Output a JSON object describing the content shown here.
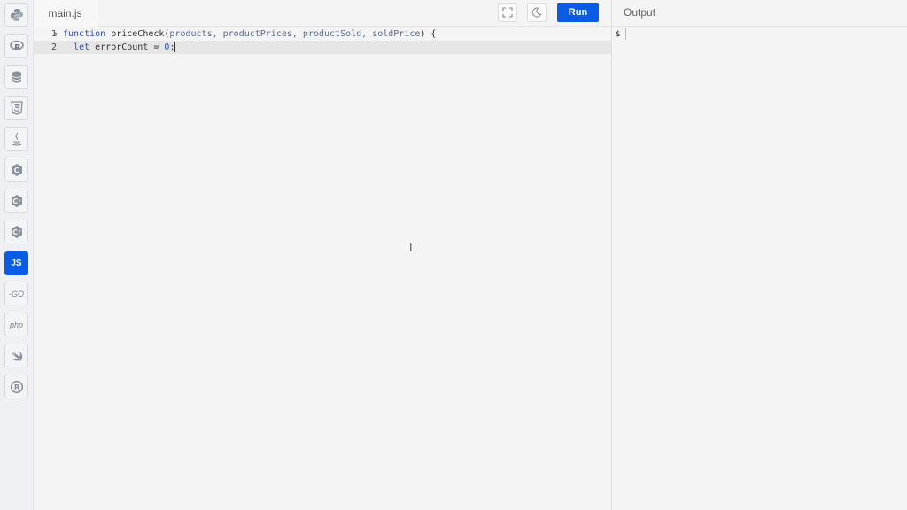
{
  "sidebar": {
    "languages": [
      {
        "name": "Python",
        "icon": "python-icon"
      },
      {
        "name": "R",
        "icon": "r-icon"
      },
      {
        "name": "SQL",
        "icon": "database-icon"
      },
      {
        "name": "HTML",
        "icon": "html5-icon"
      },
      {
        "name": "Java",
        "icon": "java-icon"
      },
      {
        "name": "C",
        "icon": "c-icon"
      },
      {
        "name": "C++",
        "icon": "cpp-icon"
      },
      {
        "name": "C#",
        "icon": "csharp-icon"
      },
      {
        "name": "JavaScript",
        "icon": "js-icon",
        "label": "JS",
        "active": true
      },
      {
        "name": "Go",
        "icon": "go-icon",
        "label": "-GO"
      },
      {
        "name": "PHP",
        "icon": "php-icon",
        "label": "php"
      },
      {
        "name": "Swift",
        "icon": "swift-icon"
      },
      {
        "name": "Rust",
        "icon": "rust-icon"
      }
    ]
  },
  "editor": {
    "file_name": "main.js",
    "run_label": "Run",
    "lines": [
      {
        "number": "1",
        "fold": "▾",
        "tokens": {
          "kw": "function",
          "name": " priceCheck(",
          "params": "products, productPrices, productSold, soldPrice",
          "tail": ") {"
        }
      },
      {
        "number": "2",
        "tokens": {
          "indent": "  ",
          "kw": "let",
          "rest": " errorCount = ",
          "num": "0",
          "tail": ";"
        }
      }
    ]
  },
  "output": {
    "title": "Output",
    "prompt": "$"
  },
  "colors": {
    "accent": "#0b5ce5",
    "keyword": "#2f4db3"
  }
}
